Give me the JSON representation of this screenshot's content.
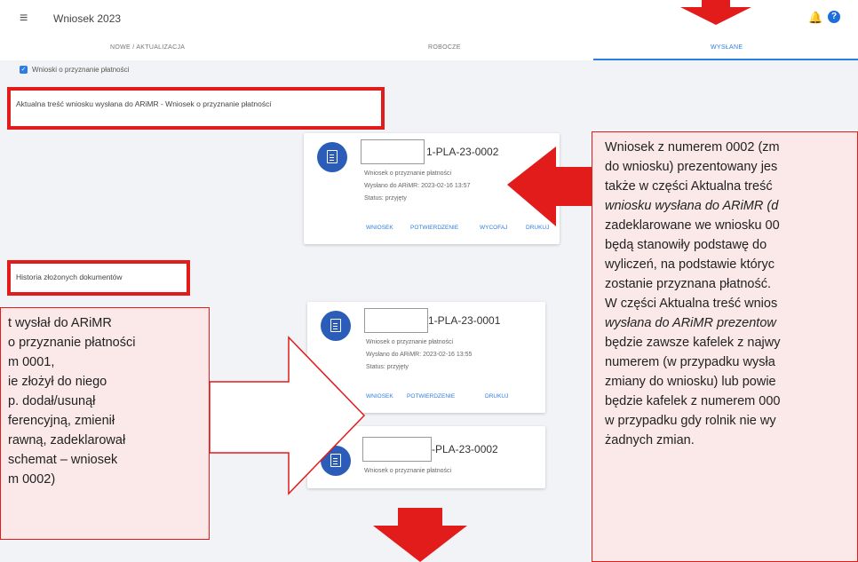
{
  "app": {
    "title": "Wniosek 2023"
  },
  "tabs": [
    {
      "label": "NOWE / AKTUALIZACJA",
      "active": false
    },
    {
      "label": "ROBOCZE",
      "active": false
    },
    {
      "label": "WYSŁANE",
      "active": true
    }
  ],
  "filter": {
    "checkbox_label": "Wnioski o przyznanie płatności",
    "checked": true
  },
  "sections": {
    "current": "Aktualna treść wniosku wysłana do ARiMR - Wniosek o przyznanie płatności",
    "history": "Historia złożonych dokumentów"
  },
  "cards": [
    {
      "number": "1-PLA-23-0002",
      "type": "Wniosek o przyznanie płatności",
      "sent": "Wysłano do ARiMR: 2023-02-16 13:57",
      "status": "Status: przyjęty",
      "links": [
        "WNIOSEK",
        "POTWIERDZENIE",
        "WYCOFAJ",
        "DRUKUJ"
      ]
    },
    {
      "number": "1-PLA-23-0001",
      "type": "Wniosek o przyznanie płatności",
      "sent": "Wysłano do ARiMR: 2023-02-16 13:55",
      "status": "Status: przyjęty",
      "links": [
        "WNIOSEK",
        "POTWIERDZENIE",
        "DRUKUJ"
      ]
    },
    {
      "number": "-PLA-23-0002",
      "type": "Wniosek o przyznanie płatności"
    }
  ],
  "notes": {
    "right": [
      "Wniosek z numerem 0002 (zm",
      "do wniosku) prezentowany jes",
      "także w części Aktualna treść",
      "wniosku wysłana do ARiMR (d",
      "zadeklarowane we wniosku 00",
      "będą stanowiły podstawę do",
      "wyliczeń, na podstawie któryc",
      "zostanie przyznana płatność.",
      "W części Aktualna treść wnios",
      "wysłana do ARiMR prezentow",
      "będzie zawsze kafelek z najwy",
      "numerem (w przypadku wysła",
      "zmiany do wniosku) lub powie",
      "będzie kafelek z numerem 000",
      "w przypadku gdy rolnik nie wy",
      "żadnych zmian."
    ],
    "left": [
      "t wysłał do ARiMR",
      "o przyznanie płatności",
      "m 0001,",
      "ie złożył do niego",
      "p. dodał/usunął",
      "ferencyjną, zmienił",
      "rawną, zadeklarował",
      "schemat – wniosek",
      "m 0002)"
    ]
  },
  "colors": {
    "accent": "#2f7de1",
    "annotation": "#e21b1b",
    "icon_bg": "#2b5db8"
  },
  "icons": [
    "menu-icon",
    "bell-icon",
    "help-icon",
    "document-icon"
  ]
}
